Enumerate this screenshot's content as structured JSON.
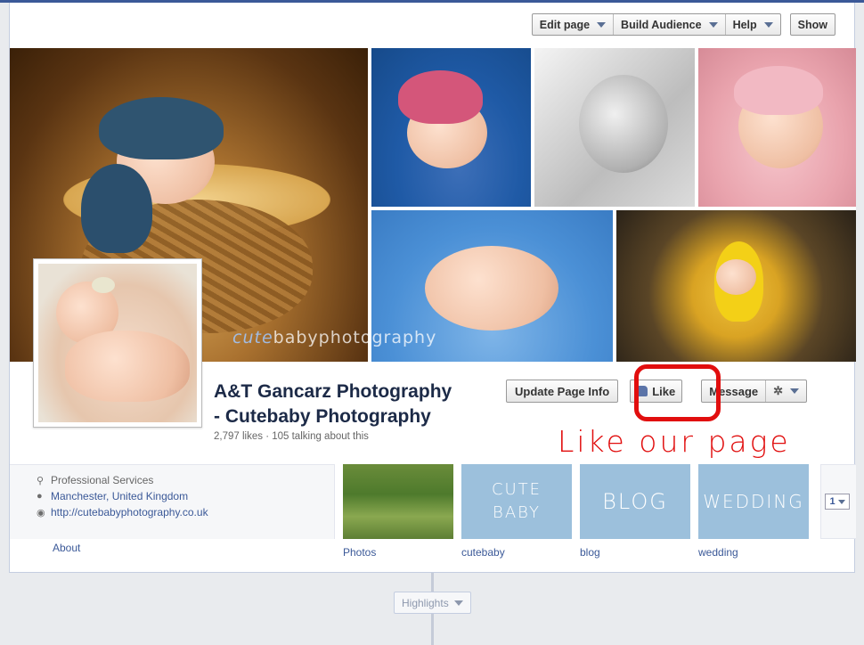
{
  "admin_bar": {
    "edit_page": "Edit page",
    "build_audience": "Build Audience",
    "help": "Help",
    "show": "Show"
  },
  "cover": {
    "watermark_cute": "cute",
    "watermark_rest": "babyphotography"
  },
  "page": {
    "name_line1": "A&T Gancarz Photography",
    "name_line2": "- Cutebaby Photography",
    "likes": "2,797 likes",
    "separator": "·",
    "talking": "105 talking about this"
  },
  "actions": {
    "update_info": "Update Page Info",
    "like": "Like",
    "message": "Message",
    "gear": "✲"
  },
  "annotation": {
    "callout": "Like our page",
    "color": "#e10e0e"
  },
  "about": {
    "category": "Professional Services",
    "location": "Manchester, United Kingdom",
    "website": "http://cutebabyphotography.co.uk",
    "about_link": "About"
  },
  "apps": [
    {
      "caption": "Photos",
      "tile_text": ""
    },
    {
      "caption": "cutebaby",
      "tile_text_1": "CUTE",
      "tile_text_2": "BABY"
    },
    {
      "caption": "blog",
      "tile_text": "BLOG"
    },
    {
      "caption": "wedding",
      "tile_text": "WEDDING"
    }
  ],
  "more_count": "1",
  "timeline": {
    "highlights": "Highlights"
  },
  "colors": {
    "brand": "#3b5998",
    "tile_blue": "#9cc0dc"
  }
}
